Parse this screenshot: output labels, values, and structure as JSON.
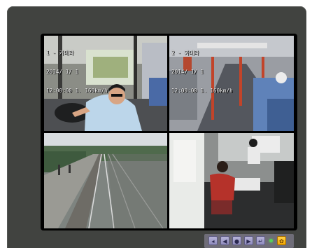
{
  "cameras": [
    {
      "osd": [
        "1 - 카메라",
        "2014/ 1/ 1",
        "12:00:00 1. 160km/h"
      ]
    },
    {
      "osd": [
        "2 - 카메라",
        "2014/ 1/ 1",
        "12:00:00 1. 160km/h"
      ]
    },
    {
      "osd": []
    },
    {
      "osd": []
    }
  ],
  "controls": [
    {
      "icon": "record-icon",
      "glyph": "◂"
    },
    {
      "icon": "rewind-icon",
      "glyph": "◀"
    },
    {
      "icon": "play-icon",
      "glyph": "●"
    },
    {
      "icon": "forward-icon",
      "glyph": "▶"
    },
    {
      "icon": "return-icon",
      "glyph": "↵"
    },
    {
      "icon": "settings-icon",
      "glyph": "✿"
    }
  ],
  "colors": {
    "bezel": "#414340",
    "button": "#9a97c8",
    "active": "#f5b000",
    "led": "#58d05a"
  }
}
